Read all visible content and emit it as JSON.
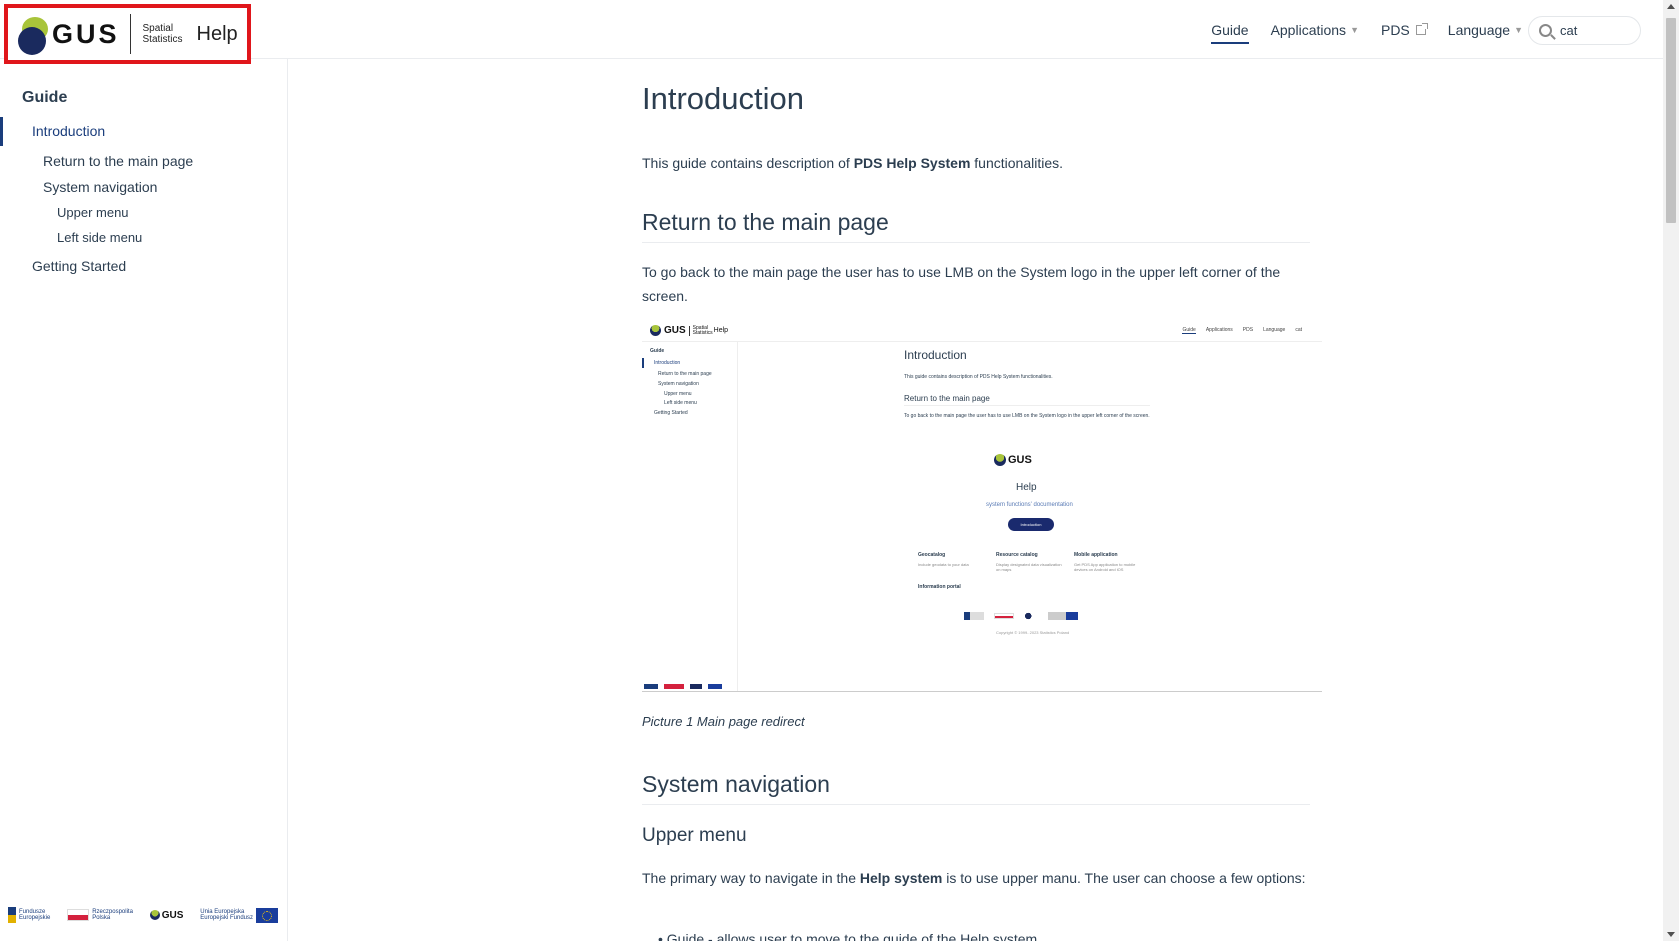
{
  "header": {
    "logo_text": "GUS",
    "logo_subtitle": "Spatial Statistics",
    "logo_help": "Help",
    "nav": [
      {
        "label": "Guide",
        "active": true
      },
      {
        "label": "Applications",
        "dropdown": true
      },
      {
        "label": "PDS",
        "external": true
      },
      {
        "label": "Language",
        "dropdown": true
      }
    ],
    "search": {
      "value": "cat"
    }
  },
  "sidebar": {
    "heading": "Guide",
    "items": [
      {
        "label": "Introduction",
        "active": true
      },
      {
        "label": "Return to the main page"
      },
      {
        "label": "System navigation"
      },
      {
        "label": "Upper menu"
      },
      {
        "label": "Left side menu"
      },
      {
        "label": "Getting Started"
      }
    ],
    "footer": {
      "fe_line1": "Fundusze",
      "fe_line2": "Europejskie",
      "pl_line1": "Rzeczpospolita",
      "pl_line2": "Polska",
      "gus": "GUS",
      "eu_line1": "Unia Europejska",
      "eu_line2": "Europejski Fundusz"
    }
  },
  "content": {
    "title": "Introduction",
    "intro_pre": "This guide contains description of ",
    "intro_bold": "PDS Help System",
    "intro_post": " functionalities.",
    "section1_title": "Return to the main page",
    "section1_text": "To go back to the main page the user has to use LMB on the System logo in the upper left corner of the screen.",
    "figure_caption": "Picture 1 Main page redirect",
    "section2_title": "System navigation",
    "subsection_title": "Upper menu",
    "upper_pre": "The primary way to navigate in the ",
    "upper_bold": "Help system",
    "upper_post": " is to use upper manu. The user can choose a few options:",
    "bullet_partial": "Guide - allows user to move to the guide of the Help system"
  },
  "figure": {
    "logo": "GUS",
    "sub": "Spatial Statistics",
    "help": "Help",
    "nav": [
      "Guide",
      "Applications",
      "PDS",
      "Language",
      "cat"
    ],
    "side_heading": "Guide",
    "side_items": [
      "Introduction",
      "Return to the main page",
      "System navigation",
      "Upper menu",
      "Left side menu",
      "Getting Started"
    ],
    "title": "Introduction",
    "intro": "This guide contains description of PDS Help System functionalities.",
    "sec": "Return to the main page",
    "sec_text": "To go back to the main page the user has to use LMB on the System logo in the upper left corner of the screen.",
    "inner_help": "Help",
    "inner_sub": "system functions' documentation",
    "inner_btn": "Introduction",
    "cards": [
      "Geocatalog",
      "Resource catalog",
      "Mobile application"
    ],
    "card_texts": [
      "Include geodata to your data",
      "Display designated data visualization on maps",
      "Get PDS App application to mobile devices on Android and iOS"
    ],
    "info": "Information portal",
    "copyright": "Copyright © 1999- 2023 Statistics Poland"
  }
}
